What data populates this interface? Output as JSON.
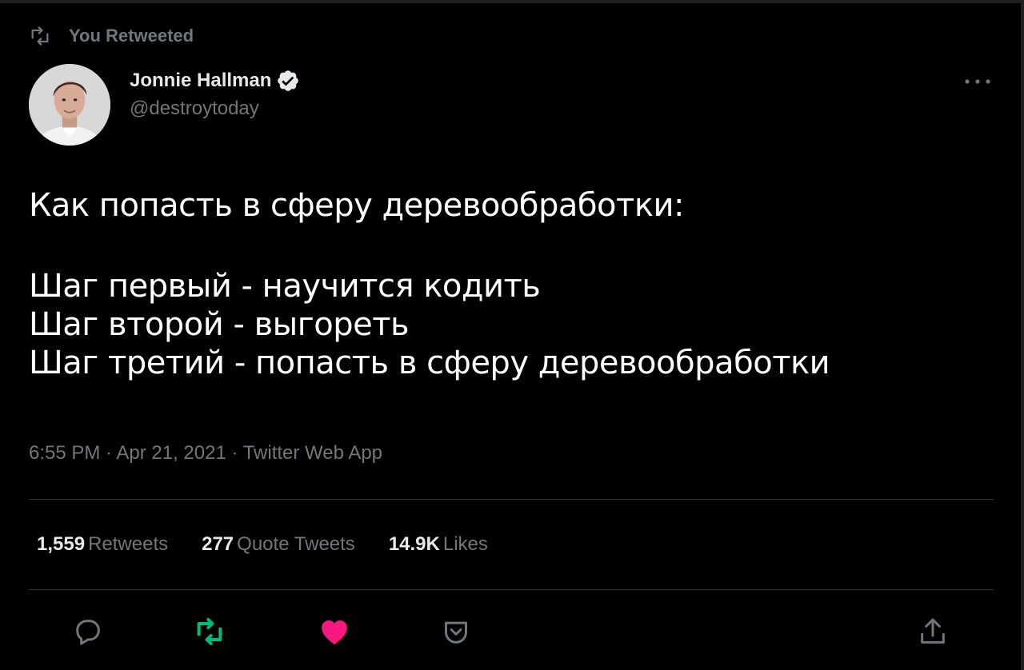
{
  "retweet_banner": {
    "label": "You Retweeted",
    "icon": "retweet-icon"
  },
  "author": {
    "display_name": "Jonnie Hallman",
    "handle": "@destroytoday",
    "verified_icon": "verified-badge-icon",
    "avatar": "avatar-photo"
  },
  "tweet": {
    "title": "Как попасть в сферу деревообработки:",
    "steps": [
      "Шаг первый - научится кодить",
      "Шаг второй - выгореть",
      "Шаг третий - попасть в сферу деревообработки"
    ]
  },
  "meta": {
    "text": "6:55 PM · Apr 21, 2021 · Twitter Web App"
  },
  "stats": [
    {
      "value": "1,559",
      "label": "Retweets"
    },
    {
      "value": "277",
      "label": "Quote Tweets"
    },
    {
      "value": "14.9K",
      "label": "Likes"
    }
  ],
  "actions": {
    "reply_icon": "reply-icon",
    "retweet_icon": "retweet-icon",
    "like_icon": "heart-icon",
    "bookmark_icon": "bookmark-icon",
    "share_icon": "share-icon"
  },
  "colors": {
    "background": "#000000",
    "text": "#e7e9ea",
    "muted": "#71767b",
    "retweet_green": "#00ba7c",
    "like_pink": "#f91880",
    "verified_blue": "#1d9bf0"
  }
}
